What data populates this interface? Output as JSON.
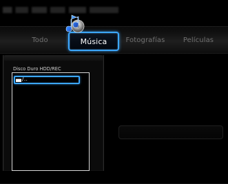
{
  "tabs": [
    {
      "label": "Todo"
    },
    {
      "label": "Música"
    },
    {
      "label": "Fotografías"
    },
    {
      "label": "Películas"
    }
  ],
  "panel": {
    "title": "Disco Duro  HDD/REC"
  },
  "list": {
    "items": [
      {
        "label": "/..",
        "icon": "folder-icon"
      }
    ]
  },
  "colors": {
    "accent": "#3ca7ff",
    "background": "#000000",
    "text_dim": "#707070"
  }
}
